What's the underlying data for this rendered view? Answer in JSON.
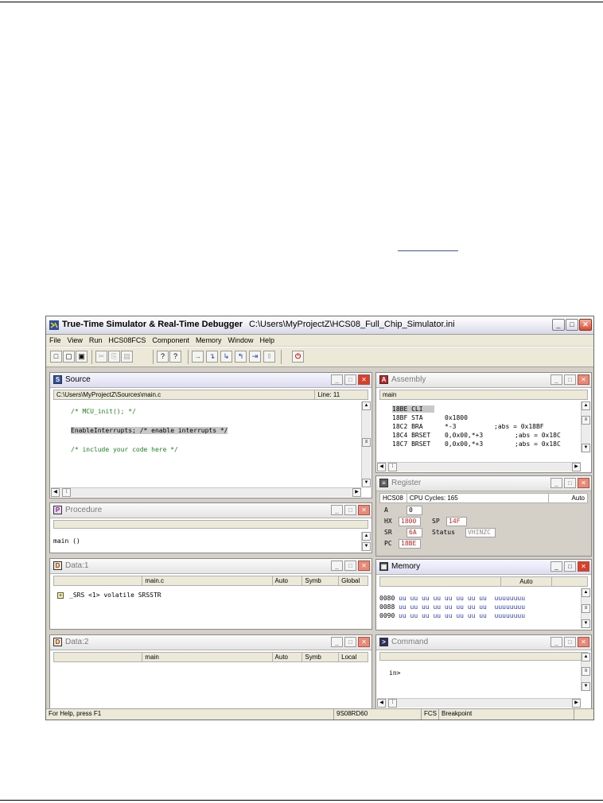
{
  "app": {
    "title": "True-Time Simulator & Real-Time Debugger",
    "ini_path": "C:\\Users\\MyProjectZ\\HCS08_Full_Chip_Simulator.ini",
    "min_label": "_",
    "max_label": "□",
    "close_label": "✕"
  },
  "menu": [
    "File",
    "View",
    "Run",
    "HCS08FCS",
    "Component",
    "Memory",
    "Window",
    "Help"
  ],
  "toolbar": {
    "new": "□",
    "open": "▢",
    "save": "▣",
    "cut": "✂",
    "copy": "⎘",
    "paste": "▤",
    "help": "?",
    "context_help": "?",
    "start": "→",
    "single_step": "↴",
    "step_over": "↳",
    "step_out": "↰",
    "assembly_step": "⇥",
    "halt": "‖",
    "reset": "⏻"
  },
  "source": {
    "title": "Source",
    "icon": "S",
    "path": "C:\\Users\\MyProjectZ\\Sources\\main.c",
    "line_label": "Line: 11",
    "lines": [
      "/* MCU_init(); */",
      "",
      "EnableInterrupts; /* enable interrupts */",
      "",
      "/* include your code here */"
    ]
  },
  "assembly": {
    "title": "Assembly",
    "header": "main",
    "rows": [
      {
        "addr": "18BE",
        "op": "CLI",
        "args": "",
        "comment": ""
      },
      {
        "addr": "18BF",
        "op": "STA",
        "args": "0x1800",
        "comment": ""
      },
      {
        "addr": "18C2",
        "op": "BRA",
        "args": "*-3",
        "comment": ";abs = 0x18BF"
      },
      {
        "addr": "18C4",
        "op": "BRSET",
        "args": "0,0x00,*+3",
        "comment": ";abs = 0x18C"
      },
      {
        "addr": "18C7",
        "op": "BRSET",
        "args": "0,0x00,*+3",
        "comment": ";abs = 0x18C"
      }
    ]
  },
  "procedure": {
    "title": "Procedure",
    "item": "main ()"
  },
  "register": {
    "title": "Register",
    "cpu": "HCS08",
    "cycles": "CPU Cycles: 165",
    "mode": "Auto",
    "a_label": "A",
    "a_value": "0",
    "hx_label": "HX",
    "hx_value": "1800",
    "sp_label": "SP",
    "sp_value": "14F",
    "sr_label": "SR",
    "sr_value": "6A",
    "status_label": "Status",
    "status_value": "VHINZC",
    "pc_label": "PC",
    "pc_value": "18BE"
  },
  "data1": {
    "title": "Data:1",
    "module": "main.c",
    "mode": "Auto",
    "format": "Symb",
    "scope": "Global",
    "var": "_SRS <1> volatile SRSSTR"
  },
  "memory": {
    "title": "Memory",
    "mode": "Auto",
    "rows": [
      {
        "addr": "0080",
        "bytes": "uu uu uu uu uu uu uu uu",
        "ascii": "uuuuuuuu"
      },
      {
        "addr": "0088",
        "bytes": "uu uu uu uu uu uu uu uu",
        "ascii": "uuuuuuuu"
      },
      {
        "addr": "0090",
        "bytes": "uu uu uu uu uu uu uu uu",
        "ascii": "uuuuuuuu"
      }
    ]
  },
  "data2": {
    "title": "Data:2",
    "module": "main",
    "mode": "Auto",
    "format": "Symb",
    "scope": "Local"
  },
  "command": {
    "title": "Command",
    "prompt": "in>"
  },
  "statusbar": {
    "help": "For Help, press F1",
    "device": "9S08RD60",
    "fcs": "FCS",
    "state": "Breakpoint"
  }
}
